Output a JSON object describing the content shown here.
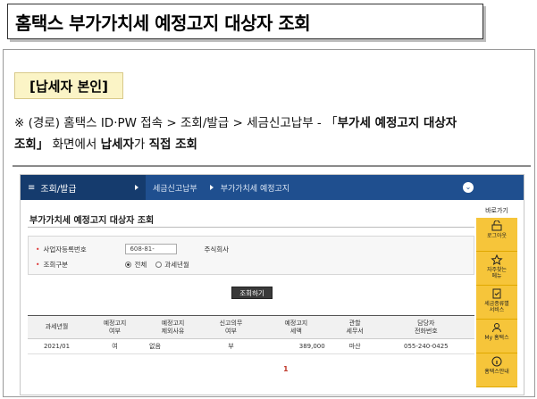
{
  "title": "홈택스 부가가치세 예정고지 대상자 조회",
  "section_tag": "[납세자 본인]",
  "description": {
    "line1_prefix": "※ (경로) 홈택스 ID·PW 접속 > 조회/발급 > 세금신고납부 - 「",
    "line1_bold": "부가세 예정고지 대상자",
    "line2_bold": "조회」",
    "line2_mid": " 화면에서 ",
    "line2_bold2": "납세자",
    "line2_mid2": "가 ",
    "line2_bold3": "직접 조회"
  },
  "nav": {
    "menu_label": "조회/발급",
    "crumb1": "세금신고납부",
    "crumb2": "부가가치세 예정고지",
    "toggle_glyph": "⌄"
  },
  "page_title": "부가가치세 예정고지 대상자 조회",
  "form": {
    "biz_label": "사업자등록번호",
    "biz_value": "608-81-",
    "company": "주식회사",
    "type_label": "조회구분",
    "opt_all": "전체",
    "opt_period": "과세년월"
  },
  "search_button": "조회하기",
  "table": {
    "headers": [
      "과세년월",
      "예정고지\n여부",
      "예정고지\n제외사유",
      "신고의무\n여부",
      "예정고지\n세액",
      "관할\n세무서",
      "담당자\n전화번호"
    ],
    "rows": [
      [
        "2021/01",
        "여",
        "없음",
        "부",
        "389,000",
        "마산",
        "055-240-0425"
      ]
    ]
  },
  "pager": "1",
  "side": {
    "head": "바로가기",
    "items": [
      "로그아웃",
      "자주찾는\n메뉴",
      "세금종류별\n서비스",
      "My 홈택스",
      "홈택스안내"
    ]
  }
}
